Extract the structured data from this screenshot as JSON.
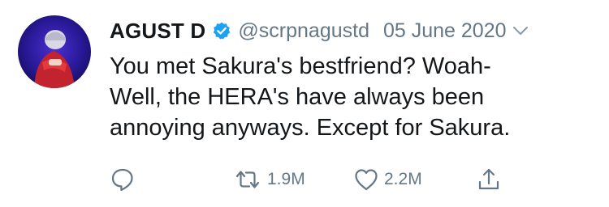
{
  "tweet": {
    "author": {
      "display_name": "AGUST D",
      "handle": "@scrpnagustd",
      "verified": true,
      "avatar_icon": "user-avatar-photo"
    },
    "date": "05 June 2020",
    "text_lines": [
      "You met Sakura's bestfriend? Woah-",
      "Well, the HERA's have always been",
      "annoying anyways. Except for Sakura."
    ],
    "actions": {
      "reply": {
        "icon": "reply-icon"
      },
      "retweet": {
        "icon": "retweet-icon",
        "count": "1.9M"
      },
      "like": {
        "icon": "heart-icon",
        "count": "2.2M"
      },
      "share": {
        "icon": "share-icon"
      }
    }
  },
  "colors": {
    "text": "#14171a",
    "secondary": "#657786",
    "verified_blue": "#1da1f2"
  }
}
